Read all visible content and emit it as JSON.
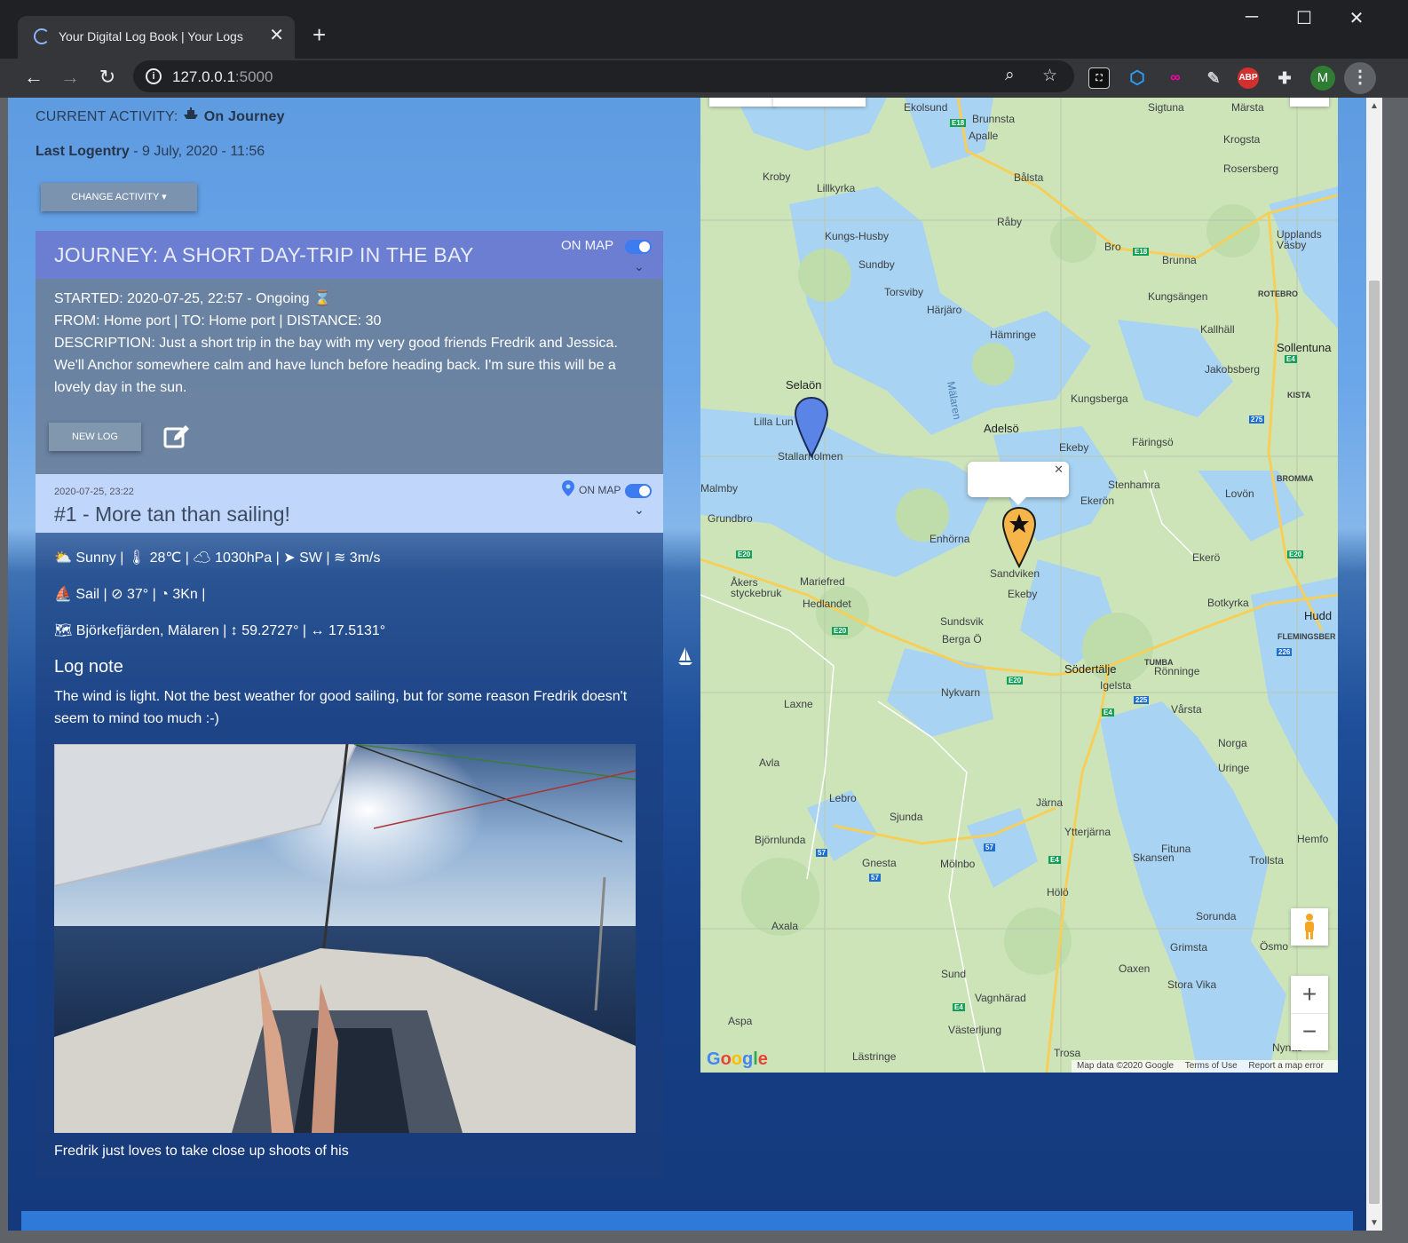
{
  "browser": {
    "tab_title": "Your Digital Log Book | Your Logs",
    "url_host": "127.0.0.1",
    "url_port": ":5000",
    "profile_initial": "M",
    "ext_abp": "ABP"
  },
  "activity": {
    "current_label": "CURRENT ACTIVITY:",
    "current_value": "On Journey",
    "last_label": "Last Logentry",
    "last_value": " - 9 July, 2020 - 11:56",
    "change_button": "CHANGE ACTIVITY"
  },
  "journey": {
    "title": "JOURNEY: A SHORT DAY-TRIP IN THE BAY",
    "on_map_label": "ON MAP",
    "started": "STARTED: 2020-07-25, 22:57 - Ongoing",
    "route": "FROM: Home port | TO: Home port | DISTANCE: 30",
    "description": "DESCRIPTION: Just a short trip in the bay with my very good friends Fredrik and Jessica. We'll Anchor somewhere calm and have lunch before heading back. I'm sure this will be a lovely day in the sun.",
    "new_log_button": "NEW LOG"
  },
  "log": {
    "date": "2020-07-25, 23:22",
    "title": "#1 - More tan than sailing!",
    "on_map_label": "ON MAP",
    "weather": "Sunny",
    "temperature": "28℃",
    "pressure": "1030hPa",
    "wind_dir": "SW",
    "wind_speed": "3m/s",
    "propulsion": "Sail",
    "heading": "37°",
    "speed": "3Kn",
    "location": "Björkefjärden, Mälaren",
    "latitude": "59.2727°",
    "longitude": "17.5131°",
    "note_heading": "Log note",
    "note": "The wind is light. Not the best weather for good sailing, but for some reason Fredrik doesn't seem to mind too much :-)",
    "caption": "Fredrik just loves to take close up shoots of his"
  },
  "map": {
    "labels": [
      "Ekolsund",
      "Brunnsta",
      "Apalle",
      "Sigtuna",
      "Märsta",
      "Krogsta",
      "Rosersberg",
      "Kroby",
      "Lillkyrka",
      "Bålsta",
      "Råby",
      "Kungs-Husby",
      "Sundby",
      "Bro",
      "Brunna",
      "Upplands Väsby",
      "Torsviby",
      "Härjäro",
      "Kungsängen",
      "Kallhäll",
      "Hämringe",
      "Sollentuna",
      "Jakobsberg",
      "Selaön",
      "Lilla Lun",
      "Stallarholmen",
      "Mälaren",
      "Adelsö",
      "Kungsberga",
      "Färingsö",
      "Ekeby",
      "Malmby",
      "Stenhamra",
      "Ekerön",
      "Lovön",
      "Grundbro",
      "Enhörna",
      "Sandviken",
      "Ekerö",
      "Åkers styckebruk",
      "Mariefred",
      "Ekeby",
      "Hedlandet",
      "Botkyrka",
      "Sundsvik",
      "Berga Ö",
      "Södertälje",
      "Rönninge",
      "Igelsta",
      "Nykvarn",
      "Laxne",
      "Vårsta",
      "Norga",
      "Avla",
      "Uringe",
      "Lebro",
      "Sjunda",
      "Järna",
      "Ytterjärna",
      "Björnlunda",
      "Gnesta",
      "Mölnbo",
      "Fituna",
      "Skansen",
      "Trollsta",
      "Hölö",
      "Axala",
      "Sorunda",
      "Grimsta",
      "Oaxen",
      "Stora Vika",
      "Ösmo",
      "Sund",
      "Vagnhärad",
      "Aspa",
      "Västerljung",
      "Trosa",
      "Lästringe",
      "Nynäs",
      "Hudd",
      "Hemfo",
      "FLEMINGSBER",
      "ROTEBRO",
      "KISTA",
      "BROMMA",
      "TUMBA"
    ],
    "google": "Google",
    "attribution": [
      "Map data ©2020 Google",
      "Terms of Use",
      "Report a map error"
    ],
    "zoom_in": "+",
    "zoom_out": "−"
  }
}
